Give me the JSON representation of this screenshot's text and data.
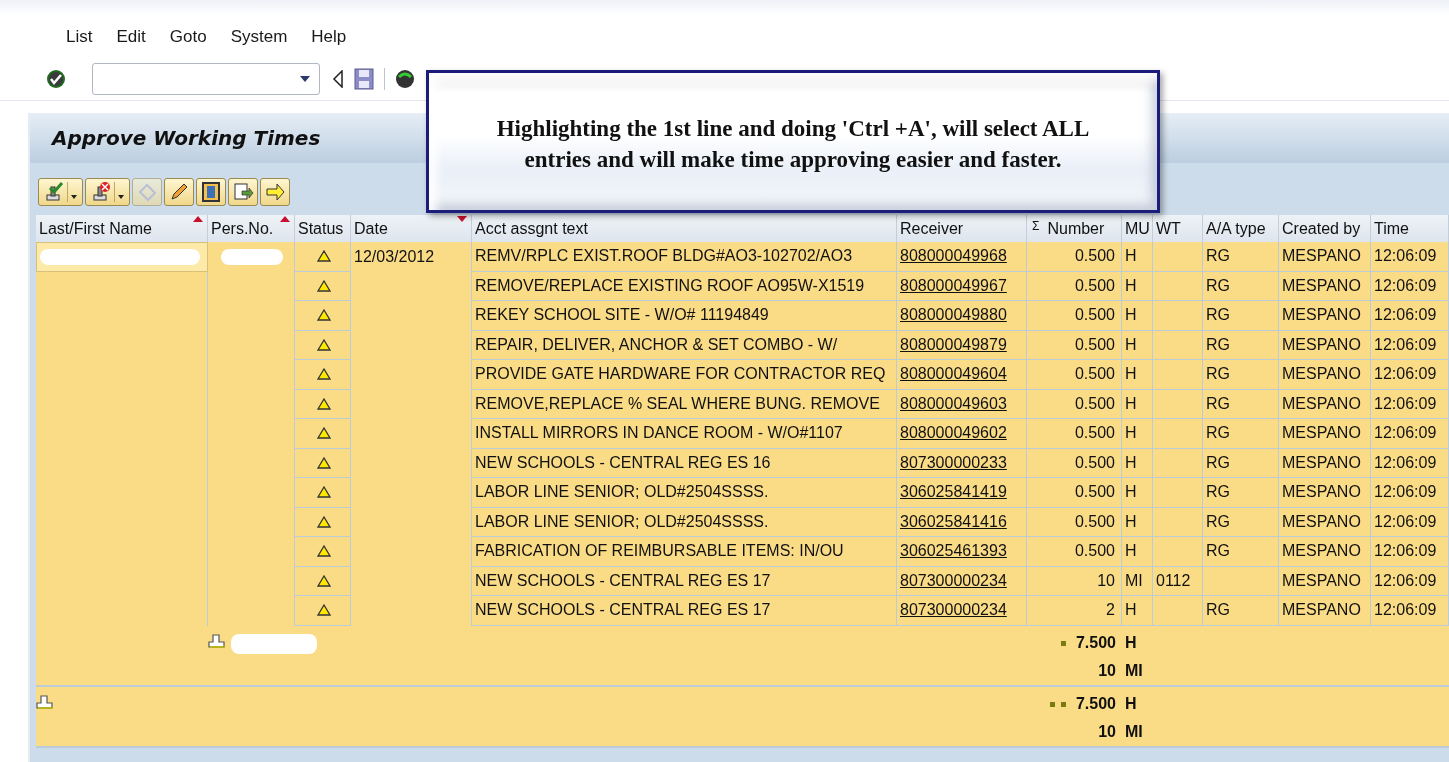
{
  "menu": [
    {
      "label": "List"
    },
    {
      "label": "Edit"
    },
    {
      "label": "Goto"
    },
    {
      "label": "System"
    },
    {
      "label": "Help"
    }
  ],
  "title": "Approve Working Times",
  "callout": {
    "lines": [
      "Highlighting the 1st line and doing 'Ctrl +A', will select ALL",
      "entries and will make time approving easier and faster."
    ]
  },
  "app_toolbar": [
    {
      "kind": "approve",
      "dropdown": true,
      "disabled": false
    },
    {
      "kind": "reject",
      "dropdown": true,
      "disabled": false
    },
    {
      "kind": "undo",
      "dropdown": false,
      "disabled": true
    },
    {
      "kind": "edit",
      "dropdown": false,
      "disabled": false
    },
    {
      "kind": "layout",
      "dropdown": false,
      "disabled": false
    },
    {
      "kind": "export",
      "dropdown": false,
      "disabled": false
    },
    {
      "kind": "next",
      "dropdown": false,
      "disabled": false
    }
  ],
  "table": {
    "columns": [
      {
        "label": "Last/First Name",
        "sort_up": true,
        "sort_down": false
      },
      {
        "label": "Pers.No.",
        "sort_up": true,
        "sort_down": false
      },
      {
        "label": "Status",
        "sort_up": false,
        "sort_down": false
      },
      {
        "label": "Date",
        "sort_up": false,
        "sort_down": true
      },
      {
        "label": "Acct assgnt text",
        "sort_up": false,
        "sort_down": false
      },
      {
        "label": "Receiver",
        "sort_up": false,
        "sort_down": false
      },
      {
        "label": "Number",
        "sort_up": false,
        "sort_down": false,
        "sum_mark": "Σ"
      },
      {
        "label": "MU",
        "sort_up": false,
        "sort_down": false
      },
      {
        "label": "WT",
        "sort_up": false,
        "sort_down": false
      },
      {
        "label": "A/A type",
        "sort_up": false,
        "sort_down": false
      },
      {
        "label": "Created by",
        "sort_up": false,
        "sort_down": false
      },
      {
        "label": "Time",
        "sort_up": false,
        "sort_down": false
      }
    ],
    "rows": [
      {
        "selected": true,
        "redacted": true,
        "warning": true,
        "date": "12/03/2012",
        "text": "REMV/RPLC EXIST.ROOF BLDG#AO3-102702/AO3",
        "receiver": "808000049968",
        "number": "0.500",
        "mu": "H",
        "aa_type": "RG",
        "created_by": "MESPANO",
        "time": "12:06:09"
      },
      {
        "selected": false,
        "redacted": false,
        "warning": true,
        "text": "REMOVE/REPLACE EXISTING ROOF AO95W-X1519",
        "receiver": "808000049967",
        "number": "0.500",
        "mu": "H",
        "aa_type": "RG",
        "created_by": "MESPANO",
        "time": "12:06:09"
      },
      {
        "selected": false,
        "redacted": false,
        "warning": true,
        "text": "REKEY SCHOOL SITE - W/O# 11194849",
        "receiver": "808000049880",
        "number": "0.500",
        "mu": "H",
        "aa_type": "RG",
        "created_by": "MESPANO",
        "time": "12:06:09"
      },
      {
        "selected": false,
        "redacted": false,
        "warning": true,
        "text": "REPAIR, DELIVER, ANCHOR & SET COMBO - W/",
        "receiver": "808000049879",
        "number": "0.500",
        "mu": "H",
        "aa_type": "RG",
        "created_by": "MESPANO",
        "time": "12:06:09"
      },
      {
        "selected": false,
        "redacted": false,
        "warning": true,
        "text": "PROVIDE GATE HARDWARE FOR CONTRACTOR REQ",
        "receiver": "808000049604",
        "number": "0.500",
        "mu": "H",
        "aa_type": "RG",
        "created_by": "MESPANO",
        "time": "12:06:09"
      },
      {
        "selected": false,
        "redacted": false,
        "warning": true,
        "text": "REMOVE,REPLACE % SEAL WHERE BUNG. REMOVE",
        "receiver": "808000049603",
        "number": "0.500",
        "mu": "H",
        "aa_type": "RG",
        "created_by": "MESPANO",
        "time": "12:06:09"
      },
      {
        "selected": false,
        "redacted": false,
        "warning": true,
        "text": "INSTALL MIRRORS IN DANCE ROOM - W/O#1107",
        "receiver": "808000049602",
        "number": "0.500",
        "mu": "H",
        "aa_type": "RG",
        "created_by": "MESPANO",
        "time": "12:06:09"
      },
      {
        "selected": false,
        "redacted": false,
        "warning": true,
        "text": "NEW SCHOOLS - CENTRAL REG ES 16",
        "receiver": "807300000233",
        "number": "0.500",
        "mu": "H",
        "aa_type": "RG",
        "created_by": "MESPANO",
        "time": "12:06:09"
      },
      {
        "selected": false,
        "redacted": false,
        "warning": true,
        "text": "LABOR LINE SENIOR; OLD#2504SSSS.",
        "receiver": "306025841419",
        "number": "0.500",
        "mu": "H",
        "aa_type": "RG",
        "created_by": "MESPANO",
        "time": "12:06:09"
      },
      {
        "selected": false,
        "redacted": false,
        "warning": true,
        "text": "LABOR LINE SENIOR; OLD#2504SSSS.",
        "receiver": "306025841416",
        "number": "0.500",
        "mu": "H",
        "aa_type": "RG",
        "created_by": "MESPANO",
        "time": "12:06:09"
      },
      {
        "selected": false,
        "redacted": false,
        "warning": true,
        "text": "FABRICATION OF REIMBURSABLE ITEMS: IN/OU",
        "receiver": "306025461393",
        "number": "0.500",
        "mu": "H",
        "aa_type": "RG",
        "created_by": "MESPANO",
        "time": "12:06:09"
      },
      {
        "selected": false,
        "redacted": false,
        "warning": true,
        "text": "NEW SCHOOLS - CENTRAL REG ES 17",
        "receiver": "807300000234",
        "number": "10",
        "mu": "MI",
        "wt": "0112",
        "created_by": "MESPANO",
        "time": "12:06:09"
      },
      {
        "selected": false,
        "redacted": false,
        "warning": true,
        "text": "NEW SCHOOLS - CENTRAL REG ES 17",
        "receiver": "807300000234",
        "number": "2",
        "mu": "H",
        "aa_type": "RG",
        "created_by": "MESPANO",
        "time": "12:06:09"
      }
    ],
    "totals": [
      {
        "kind": "subtotal",
        "redacted": true,
        "lines": [
          {
            "value": "7.500",
            "unit": "H"
          },
          {
            "value": "10",
            "unit": "MI"
          }
        ]
      },
      {
        "kind": "total",
        "redacted": false,
        "lines": [
          {
            "value": "7.500",
            "unit": "H"
          },
          {
            "value": "10",
            "unit": "MI"
          }
        ]
      }
    ]
  }
}
